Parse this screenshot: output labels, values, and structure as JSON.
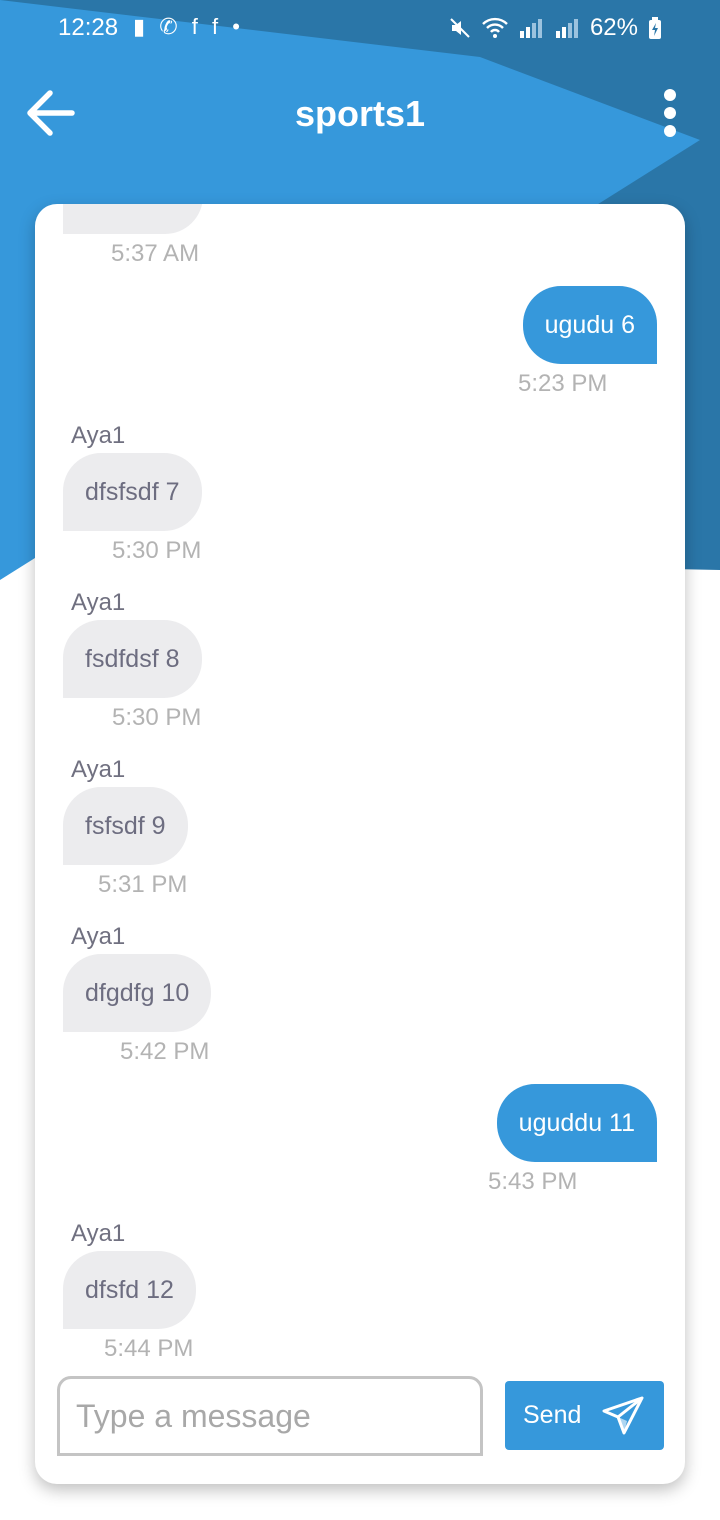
{
  "status_bar": {
    "time": "12:28",
    "left_icons": "▮ ✆ f f •",
    "battery": "62%"
  },
  "app_bar": {
    "title": "sports1"
  },
  "messages": [
    {
      "dir": "in",
      "sender": "",
      "text": "",
      "time": "5:37 AM"
    },
    {
      "dir": "out",
      "sender": "",
      "text": "ugudu 6",
      "time": "5:23 PM"
    },
    {
      "dir": "in",
      "sender": "Aya1",
      "text": "dfsfsdf 7",
      "time": "5:30 PM"
    },
    {
      "dir": "in",
      "sender": "Aya1",
      "text": "fsdfdsf 8",
      "time": "5:30 PM"
    },
    {
      "dir": "in",
      "sender": "Aya1",
      "text": "fsfsdf 9",
      "time": "5:31 PM"
    },
    {
      "dir": "in",
      "sender": "Aya1",
      "text": "dfgdfg 10",
      "time": "5:42 PM"
    },
    {
      "dir": "out",
      "sender": "",
      "text": "uguddu 11",
      "time": "5:43 PM"
    },
    {
      "dir": "in",
      "sender": "Aya1",
      "text": "dfsfd 12",
      "time": "5:44 PM"
    }
  ],
  "composer": {
    "placeholder": "Type a message",
    "send_label": "Send"
  },
  "colors": {
    "primary": "#3698db",
    "primary_dark": "#2a76a8",
    "incoming_bubble": "#ececee"
  },
  "icons": {
    "back": "arrow-left-icon",
    "menu": "more-vertical-icon",
    "send": "paper-plane-icon"
  }
}
